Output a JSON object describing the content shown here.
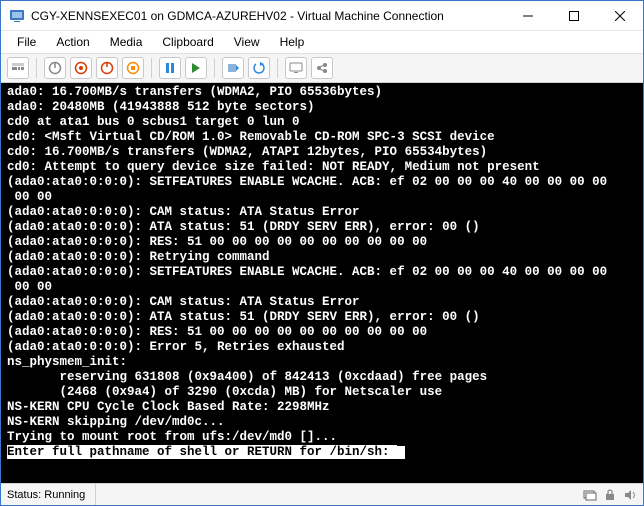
{
  "window": {
    "title": "CGY-XENNSEXEC01 on GDMCA-AZUREHV02 - Virtual Machine Connection"
  },
  "menu": {
    "file": "File",
    "action": "Action",
    "media": "Media",
    "clipboard": "Clipboard",
    "view": "View",
    "help": "Help"
  },
  "console_lines": [
    "ada0: 16.700MB/s transfers (WDMA2, PIO 65536bytes)",
    "ada0: 20480MB (41943888 512 byte sectors)",
    "cd0 at ata1 bus 0 scbus1 target 0 lun 0",
    "cd0: <Msft Virtual CD/ROM 1.0> Removable CD-ROM SPC-3 SCSI device",
    "cd0: 16.700MB/s transfers (WDMA2, ATAPI 12bytes, PIO 65534bytes)",
    "cd0: Attempt to query device size failed: NOT READY, Medium not present",
    "(ada0:ata0:0:0:0): SETFEATURES ENABLE WCACHE. ACB: ef 02 00 00 00 40 00 00 00 00",
    " 00 00",
    "(ada0:ata0:0:0:0): CAM status: ATA Status Error",
    "(ada0:ata0:0:0:0): ATA status: 51 (DRDY SERV ERR), error: 00 ()",
    "(ada0:ata0:0:0:0): RES: 51 00 00 00 00 00 00 00 00 00 00",
    "(ada0:ata0:0:0:0): Retrying command",
    "(ada0:ata0:0:0:0): SETFEATURES ENABLE WCACHE. ACB: ef 02 00 00 00 40 00 00 00 00",
    " 00 00",
    "(ada0:ata0:0:0:0): CAM status: ATA Status Error",
    "(ada0:ata0:0:0:0): ATA status: 51 (DRDY SERV ERR), error: 00 ()",
    "(ada0:ata0:0:0:0): RES: 51 00 00 00 00 00 00 00 00 00 00",
    "(ada0:ata0:0:0:0): Error 5, Retries exhausted",
    "ns_physmem_init:",
    "       reserving 631808 (0x9a400) of 842413 (0xcdaad) free pages",
    "       (2468 (0x9a4) of 3290 (0xcda) MB) for Netscaler use",
    "NS-KERN CPU Cycle Clock Based Rate: 2298MHz",
    "NS-KERN skipping /dev/md0c...",
    "Trying to mount root from ufs:/dev/md0 []..."
  ],
  "prompt": "Enter full pathname of shell or RETURN for /bin/sh: ",
  "status": {
    "text": "Status: Running"
  },
  "colors": {
    "power_green": "#23a523",
    "power_red": "#d83b01",
    "power_orange": "#ff8c00",
    "pause_blue": "#2b88d8",
    "play_green": "#2e8b2e",
    "arrow_blue": "#2b88d8"
  }
}
